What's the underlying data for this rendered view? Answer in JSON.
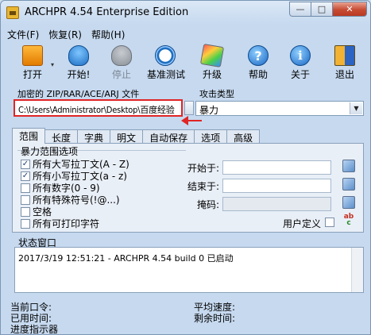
{
  "window": {
    "title": "ARCHPR 4.54 Enterprise Edition",
    "min_label": "—",
    "max_label": "□",
    "close_label": "✕"
  },
  "menu": [
    "文件(F)",
    "恢复(R)",
    "帮助(H)"
  ],
  "toolbar": [
    {
      "label": "打开",
      "icon": "folder-open-icon",
      "enabled": true
    },
    {
      "label": "开始!",
      "icon": "start-figure-icon",
      "enabled": true
    },
    {
      "label": "停止",
      "icon": "stop-figure-icon",
      "enabled": false
    },
    {
      "label": "基准测试",
      "icon": "stopwatch-icon",
      "enabled": true
    },
    {
      "label": "升级",
      "icon": "upgrade-icon",
      "enabled": true
    },
    {
      "label": "帮助",
      "icon": "help-icon",
      "enabled": true
    },
    {
      "label": "关于",
      "icon": "info-icon",
      "enabled": true
    },
    {
      "label": "退出",
      "icon": "exit-door-icon",
      "enabled": true
    }
  ],
  "file": {
    "label": "加密的 ZIP/RAR/ACE/ARJ 文件",
    "value": "C:\\Users\\Administrator\\Desktop\\百度经验"
  },
  "attack": {
    "label": "攻击类型",
    "value": "暴力"
  },
  "tabs": [
    "范围",
    "长度",
    "字典",
    "明文",
    "自动保存",
    "选项",
    "高级"
  ],
  "active_tab": 0,
  "range": {
    "title": "暴力范围选项",
    "options": [
      {
        "label": "所有大写拉丁文(A - Z)",
        "checked": true
      },
      {
        "label": "所有小写拉丁文(a - z)",
        "checked": true
      },
      {
        "label": "所有数字(0 - 9)",
        "checked": false
      },
      {
        "label": "所有特殊符号(!@...)",
        "checked": false
      },
      {
        "label": "空格",
        "checked": false
      },
      {
        "label": "所有可打印字符",
        "checked": false
      }
    ],
    "start_label": "开始于:",
    "start_value": "",
    "end_label": "结束于:",
    "end_value": "",
    "mask_label": "掩码:",
    "mask_value": "",
    "user_defined_label": "用户定义"
  },
  "status": {
    "label": "状态窗口",
    "log": "2017/3/19 12:51:21 - ARCHPR 4.54 build 0 已启动"
  },
  "bottom": {
    "current_pw_label": "当前口令:",
    "avg_speed_label": "平均速度:",
    "elapsed_label": "已用时间:",
    "remaining_label": "剩余时间:",
    "progress_label": "进度指示器"
  }
}
